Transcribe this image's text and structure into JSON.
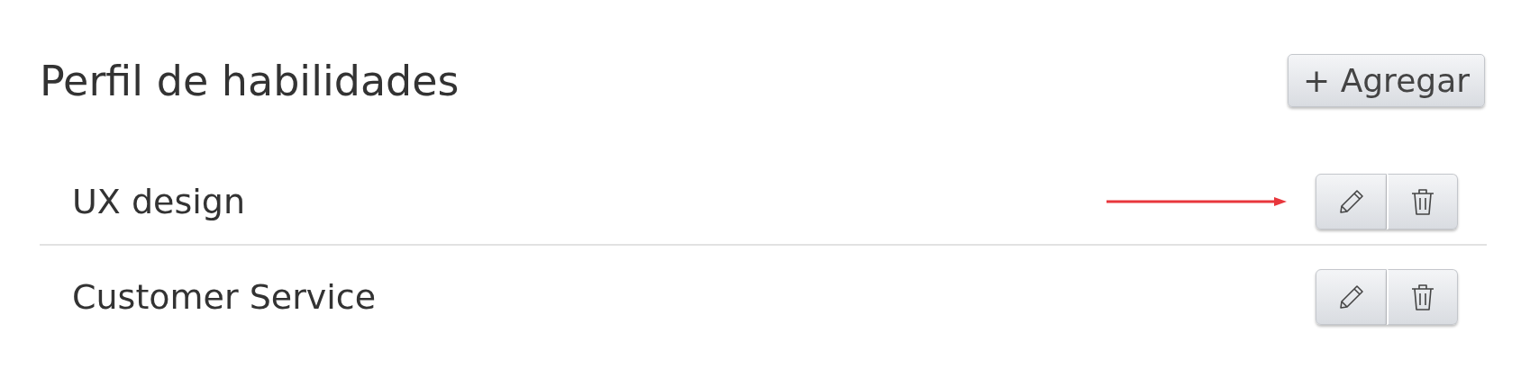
{
  "title": "Perfil de habilidades",
  "add_button": {
    "label": "+ Agregar"
  },
  "skills": [
    {
      "name": "UX design",
      "highlighted": true
    },
    {
      "name": "Customer Service",
      "highlighted": false
    }
  ]
}
